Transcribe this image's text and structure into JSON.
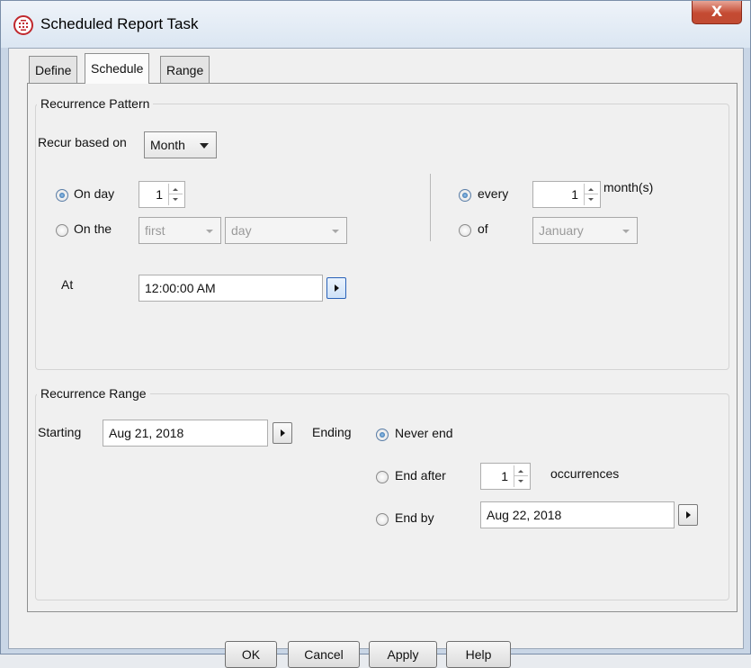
{
  "window": {
    "title": "Scheduled Report Task",
    "close_label": "X"
  },
  "tabs": [
    {
      "label": "Define",
      "active": false
    },
    {
      "label": "Schedule",
      "active": true
    },
    {
      "label": "Range",
      "active": false
    }
  ],
  "pattern": {
    "legend": "Recurrence Pattern",
    "recur_label": "Recur based on",
    "recur_value": "Month",
    "on_day_label": "On day",
    "on_day_value": "1",
    "on_day_selected": true,
    "on_the_label": "On the",
    "on_the_ordinal": "first",
    "on_the_unit": "day",
    "every_label": "every",
    "every_value": "1",
    "every_unit": "month(s)",
    "every_selected": true,
    "of_label": "of",
    "of_month": "January",
    "at_label": "At",
    "at_value": "12:00:00 AM"
  },
  "range": {
    "legend": "Recurrence Range",
    "starting_label": "Starting",
    "starting_value": "Aug 21, 2018",
    "ending_label": "Ending",
    "never_end_label": "Never end",
    "never_end_selected": true,
    "end_after_label": "End after",
    "end_after_value": "1",
    "occurrences_label": "occurrences",
    "end_by_label": "End by",
    "end_by_value": "Aug 22, 2018"
  },
  "buttons": {
    "ok": "OK",
    "cancel": "Cancel",
    "apply": "Apply",
    "help": "Help"
  },
  "colors": {
    "accent": "#1f5e9c",
    "close": "#c44a32"
  }
}
